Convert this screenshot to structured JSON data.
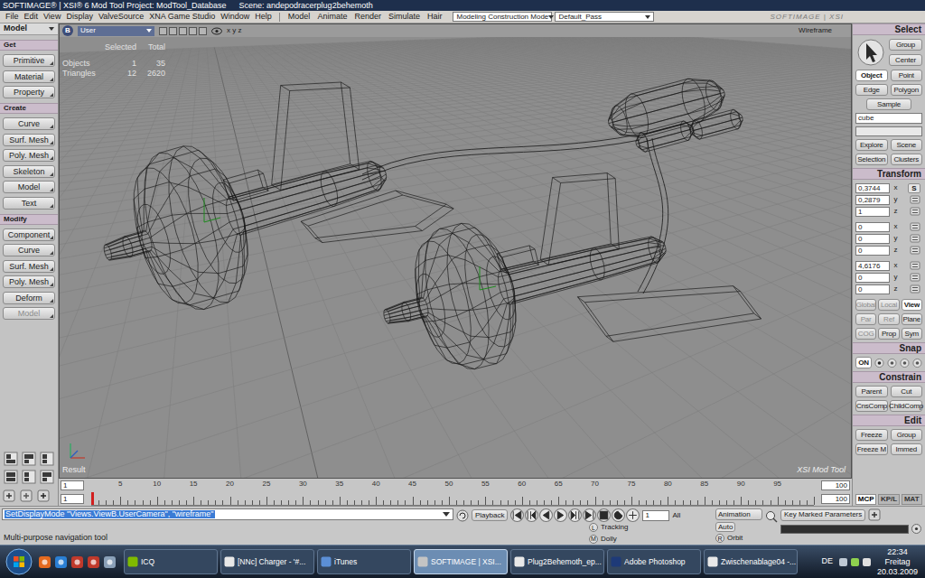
{
  "window": {
    "title": "SOFTIMAGE® | XSI® 6 Mod Tool Project: ModTool_Database",
    "scene": "Scene: andepodracerplug2behemoth"
  },
  "menu": [
    "File",
    "Edit",
    "View",
    "Display",
    "ValveSource",
    "XNA Game Studio",
    "Window",
    "Help"
  ],
  "modules": [
    "Model",
    "Animate",
    "Render",
    "Simulate",
    "Hair"
  ],
  "mode": "Modeling Construction Mode",
  "pass": "Default_Pass",
  "logo": "SOFTIMAGE | XSI",
  "toolbar": {
    "module": "Model",
    "sections": [
      {
        "title": "Get",
        "buttons": [
          {
            "label": "Primitive",
            "disabled": false
          },
          {
            "label": "Material",
            "disabled": false
          },
          {
            "label": "Property",
            "disabled": false
          }
        ]
      },
      {
        "title": "Create",
        "buttons": [
          {
            "label": "Curve",
            "disabled": false
          },
          {
            "label": "Surf. Mesh",
            "disabled": false
          },
          {
            "label": "Poly. Mesh",
            "disabled": false
          },
          {
            "label": "Skeleton",
            "disabled": false
          },
          {
            "label": "Model",
            "disabled": false
          },
          {
            "label": "Text",
            "disabled": false
          }
        ]
      },
      {
        "title": "Modify",
        "buttons": [
          {
            "label": "Component",
            "disabled": false
          },
          {
            "label": "Curve",
            "disabled": false
          },
          {
            "label": "Surf. Mesh",
            "disabled": false
          },
          {
            "label": "Poly. Mesh",
            "disabled": false
          },
          {
            "label": "Deform",
            "disabled": false
          },
          {
            "label": "Model",
            "disabled": true
          }
        ]
      }
    ]
  },
  "viewport": {
    "view": "B",
    "camera": "User",
    "axes": "x y z",
    "display": "Wireframe",
    "stats_header": [
      "Selected",
      "Total"
    ],
    "stats": [
      {
        "label": "Objects",
        "sel": "1",
        "total": "35"
      },
      {
        "label": "Triangles",
        "sel": "12",
        "total": "2620"
      }
    ],
    "region": "Result",
    "product": "XSI Mod Tool"
  },
  "timeline": {
    "start": "1",
    "view_start": "1",
    "end": "100",
    "view_end": "100",
    "ticks": [
      "5",
      "10",
      "15",
      "20",
      "25",
      "30",
      "35",
      "40",
      "45",
      "50",
      "55",
      "60",
      "65",
      "70",
      "75",
      "80",
      "85",
      "90",
      "95"
    ],
    "marker": 0
  },
  "command": "SetDisplayMode \"Views.ViewB.UserCamera\", \"wireframe\"",
  "playback": {
    "label": "Playback",
    "frame": "1",
    "range": "All",
    "animation": "Animation",
    "auto": "Auto",
    "keys": "Key Marked Parameters"
  },
  "status": {
    "text": "Multi-purpose navigation tool",
    "mouse": [
      {
        "button": "L",
        "action": "Tracking"
      },
      {
        "button": "M",
        "action": "Dolly"
      },
      {
        "button": "R",
        "action": "Orbit"
      }
    ]
  },
  "select": {
    "title": "Select",
    "actions": [
      "Group",
      "Center"
    ],
    "filters": [
      {
        "label": "Object",
        "selected": true
      },
      {
        "label": "Point",
        "selected": false
      },
      {
        "label": "Edge",
        "selected": false
      },
      {
        "label": "Polygon",
        "selected": false
      }
    ],
    "sample": "Sample",
    "name": "cube",
    "browse": [
      "Explore",
      "Scene",
      "Selection",
      "Clusters"
    ]
  },
  "transform": {
    "title": "Transform",
    "groups": [
      {
        "kind": "scale",
        "label": "S",
        "values": [
          {
            "value": "0,3744",
            "axis": "x"
          },
          {
            "value": "0,2879",
            "axis": "y"
          },
          {
            "value": "1",
            "axis": "z"
          }
        ]
      },
      {
        "kind": "rotate",
        "values": [
          {
            "value": "0",
            "axis": "x"
          },
          {
            "value": "0",
            "axis": "y"
          },
          {
            "value": "0",
            "axis": "z"
          }
        ]
      },
      {
        "kind": "translate",
        "values": [
          {
            "value": "4,6176",
            "axis": "x"
          },
          {
            "value": "0",
            "axis": "y"
          },
          {
            "value": "0",
            "axis": "z"
          }
        ]
      }
    ],
    "modes": [
      [
        {
          "label": "Global",
          "selected": false,
          "disabled": true
        },
        {
          "label": "Local",
          "selected": false,
          "disabled": true
        },
        {
          "label": "View",
          "selected": true,
          "disabled": false
        }
      ],
      [
        {
          "label": "Par",
          "selected": false,
          "disabled": true
        },
        {
          "label": "Ref",
          "selected": false,
          "disabled": true
        },
        {
          "label": "Plane",
          "selected": false,
          "disabled": false
        }
      ],
      [
        {
          "label": "COG",
          "selected": false,
          "disabled": true
        },
        {
          "label": "Prop",
          "selected": false,
          "disabled": false
        },
        {
          "label": "Sym",
          "selected": false,
          "disabled": false
        }
      ]
    ]
  },
  "snap": {
    "title": "Snap",
    "toggle": "ON",
    "on": true
  },
  "constrain": {
    "title": "Constrain",
    "buttons": [
      "Parent",
      "Cut",
      "CnsComp",
      "ChildComp"
    ]
  },
  "edit": {
    "title": "Edit",
    "buttons": [
      "Freeze",
      "Group",
      "Freeze M",
      "Immed"
    ]
  },
  "panel_tabs": [
    {
      "label": "MCP",
      "selected": true
    },
    {
      "label": "KP/L",
      "selected": false
    },
    {
      "label": "MAT",
      "selected": false
    }
  ],
  "taskbar": {
    "tasks": [
      {
        "label": "ICQ",
        "active": false
      },
      {
        "label": "[NNc] Charger - '#...",
        "active": false
      },
      {
        "label": "iTunes",
        "active": false
      },
      {
        "label": "SOFTIMAGE | XSI...",
        "active": true
      },
      {
        "label": "Plug2Behemoth_ep...",
        "active": false
      },
      {
        "label": "Adobe Photoshop",
        "active": false
      },
      {
        "label": "Zwischenablage04 -...",
        "active": false
      }
    ],
    "lang": "DE",
    "time": "22:34",
    "day": "Freitag",
    "date": "20.03.2009"
  }
}
